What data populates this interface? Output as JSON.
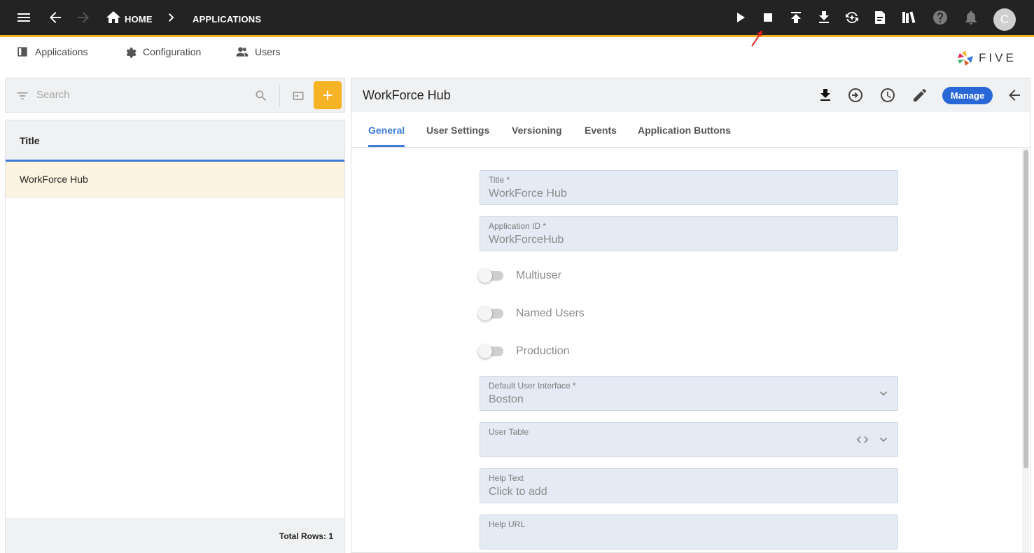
{
  "topbar": {
    "breadcrumb": {
      "home": "HOME",
      "current": "APPLICATIONS"
    },
    "avatar_initial": "C",
    "icons": [
      "menu-icon",
      "back-arrow-icon",
      "forward-arrow-icon",
      "home-icon",
      "chevron-right-icon",
      "play-icon",
      "stop-icon",
      "upload-icon",
      "download-icon",
      "deploy-icon",
      "document-icon",
      "library-icon",
      "help-icon",
      "bell-icon"
    ]
  },
  "subnav": {
    "items": [
      {
        "label": "Applications",
        "icon": "applications-icon"
      },
      {
        "label": "Configuration",
        "icon": "configuration-icon"
      },
      {
        "label": "Users",
        "icon": "users-icon"
      }
    ],
    "logo_text": "FIVE"
  },
  "list": {
    "search_placeholder": "Search",
    "add_label": "+",
    "column_title": "Title",
    "rows": [
      "WorkForce Hub"
    ],
    "footer": "Total Rows: 1"
  },
  "detail": {
    "title": "WorkForce Hub",
    "manage_label": "Manage",
    "tabs": [
      "General",
      "User Settings",
      "Versioning",
      "Events",
      "Application Buttons"
    ],
    "active_tab": "General",
    "fields": {
      "title": {
        "label": "Title *",
        "value": "WorkForce Hub"
      },
      "application_id": {
        "label": "Application ID *",
        "value": "WorkForceHub"
      },
      "default_ui": {
        "label": "Default User Interface *",
        "value": "Boston"
      },
      "user_table": {
        "label": "User Table",
        "value": ""
      },
      "help_text": {
        "label": "Help Text",
        "value": "Click to add"
      },
      "help_url": {
        "label": "Help URL",
        "value": ""
      }
    },
    "toggles": [
      {
        "label": "Multiuser",
        "on": false
      },
      {
        "label": "Named Users",
        "on": false
      },
      {
        "label": "Production",
        "on": false
      }
    ]
  },
  "colors": {
    "topbar_bg": "#232323",
    "accent_yellow": "#f5b325",
    "accent_blue": "#3d7bd6",
    "manage_blue": "#2967d6",
    "selected_row": "#fdf3e1",
    "field_bg": "#e4ebf4"
  }
}
